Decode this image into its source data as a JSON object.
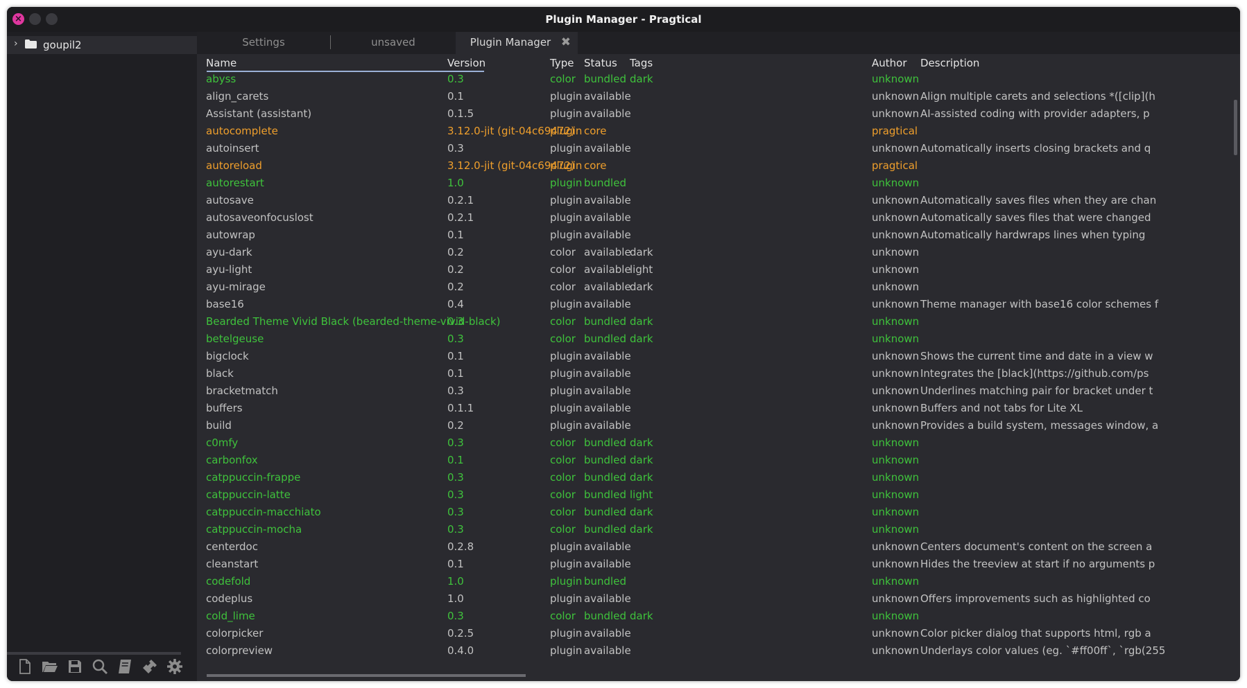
{
  "window": {
    "title": "Plugin Manager - Pragtical"
  },
  "sidebar": {
    "folder": "goupil2",
    "toolbar": [
      {
        "icon": "new-file-icon"
      },
      {
        "icon": "open-folder-icon"
      },
      {
        "icon": "save-icon"
      },
      {
        "icon": "search-icon"
      },
      {
        "icon": "book-icon"
      },
      {
        "icon": "plugin-icon"
      },
      {
        "icon": "gear-icon"
      }
    ]
  },
  "tabs": [
    {
      "label": "Settings"
    },
    {
      "label": "unsaved"
    },
    {
      "label": "Plugin Manager",
      "active": true
    }
  ],
  "table": {
    "columns": [
      "Name",
      "Version",
      "Type",
      "Status",
      "Tags",
      "Author",
      "Description"
    ],
    "status_colors": {
      "available": "#c2c2c2",
      "bundled": "#3fc23c",
      "core": "#ef9f2c"
    },
    "rows": [
      {
        "name": "abyss",
        "version": "0.3",
        "type": "color",
        "status": "bundled",
        "tags": "dark",
        "author": "unknown",
        "description": ""
      },
      {
        "name": "align_carets",
        "version": "0.1",
        "type": "plugin",
        "status": "available",
        "tags": "",
        "author": "unknown",
        "description": "Align multiple carets and selections *([clip](h"
      },
      {
        "name": "Assistant (assistant)",
        "version": "0.1.5",
        "type": "plugin",
        "status": "available",
        "tags": "",
        "author": "unknown",
        "description": "AI-assisted coding with provider adapters, p"
      },
      {
        "name": "autocomplete",
        "version": "3.12.0-jit (git-04c69472)",
        "type": "plugin",
        "status": "core",
        "tags": "",
        "author": "pragtical",
        "description": ""
      },
      {
        "name": "autoinsert",
        "version": "0.3",
        "type": "plugin",
        "status": "available",
        "tags": "",
        "author": "unknown",
        "description": "Automatically inserts closing brackets and q"
      },
      {
        "name": "autoreload",
        "version": "3.12.0-jit (git-04c69472)",
        "type": "plugin",
        "status": "core",
        "tags": "",
        "author": "pragtical",
        "description": ""
      },
      {
        "name": "autorestart",
        "version": "1.0",
        "type": "plugin",
        "status": "bundled",
        "tags": "",
        "author": "unknown",
        "description": ""
      },
      {
        "name": "autosave",
        "version": "0.2.1",
        "type": "plugin",
        "status": "available",
        "tags": "",
        "author": "unknown",
        "description": "Automatically saves files when they are chan"
      },
      {
        "name": "autosaveonfocuslost",
        "version": "0.2.1",
        "type": "plugin",
        "status": "available",
        "tags": "",
        "author": "unknown",
        "description": "Automatically saves files that were changed"
      },
      {
        "name": "autowrap",
        "version": "0.1",
        "type": "plugin",
        "status": "available",
        "tags": "",
        "author": "unknown",
        "description": "Automatically hardwraps lines when typing"
      },
      {
        "name": "ayu-dark",
        "version": "0.2",
        "type": "color",
        "status": "available",
        "tags": "dark",
        "author": "unknown",
        "description": ""
      },
      {
        "name": "ayu-light",
        "version": "0.2",
        "type": "color",
        "status": "available",
        "tags": "light",
        "author": "unknown",
        "description": ""
      },
      {
        "name": "ayu-mirage",
        "version": "0.2",
        "type": "color",
        "status": "available",
        "tags": "dark",
        "author": "unknown",
        "description": ""
      },
      {
        "name": "base16",
        "version": "0.4",
        "type": "plugin",
        "status": "available",
        "tags": "",
        "author": "unknown",
        "description": "Theme manager with base16 color schemes f"
      },
      {
        "name": "Bearded Theme Vivid Black (bearded-theme-vivid-black)",
        "version": "0.3",
        "type": "color",
        "status": "bundled",
        "tags": "dark",
        "author": "unknown",
        "description": ""
      },
      {
        "name": "betelgeuse",
        "version": "0.3",
        "type": "color",
        "status": "bundled",
        "tags": "dark",
        "author": "unknown",
        "description": ""
      },
      {
        "name": "bigclock",
        "version": "0.1",
        "type": "plugin",
        "status": "available",
        "tags": "",
        "author": "unknown",
        "description": "Shows the current time and date in a view w"
      },
      {
        "name": "black",
        "version": "0.1",
        "type": "plugin",
        "status": "available",
        "tags": "",
        "author": "unknown",
        "description": "Integrates the [black](https://github.com/ps"
      },
      {
        "name": "bracketmatch",
        "version": "0.3",
        "type": "plugin",
        "status": "available",
        "tags": "",
        "author": "unknown",
        "description": "Underlines matching pair for bracket under t"
      },
      {
        "name": "buffers",
        "version": "0.1.1",
        "type": "plugin",
        "status": "available",
        "tags": "",
        "author": "unknown",
        "description": "Buffers and not tabs for Lite XL"
      },
      {
        "name": "build",
        "version": "0.2",
        "type": "plugin",
        "status": "available",
        "tags": "",
        "author": "unknown",
        "description": "Provides a build system, messages window, a"
      },
      {
        "name": "c0mfy",
        "version": "0.3",
        "type": "color",
        "status": "bundled",
        "tags": "dark",
        "author": "unknown",
        "description": ""
      },
      {
        "name": "carbonfox",
        "version": "0.1",
        "type": "color",
        "status": "bundled",
        "tags": "dark",
        "author": "unknown",
        "description": ""
      },
      {
        "name": "catppuccin-frappe",
        "version": "0.3",
        "type": "color",
        "status": "bundled",
        "tags": "dark",
        "author": "unknown",
        "description": ""
      },
      {
        "name": "catppuccin-latte",
        "version": "0.3",
        "type": "color",
        "status": "bundled",
        "tags": "light",
        "author": "unknown",
        "description": ""
      },
      {
        "name": "catppuccin-macchiato",
        "version": "0.3",
        "type": "color",
        "status": "bundled",
        "tags": "dark",
        "author": "unknown",
        "description": ""
      },
      {
        "name": "catppuccin-mocha",
        "version": "0.3",
        "type": "color",
        "status": "bundled",
        "tags": "dark",
        "author": "unknown",
        "description": ""
      },
      {
        "name": "centerdoc",
        "version": "0.2.8",
        "type": "plugin",
        "status": "available",
        "tags": "",
        "author": "unknown",
        "description": "Centers document's content on the screen a"
      },
      {
        "name": "cleanstart",
        "version": "0.1",
        "type": "plugin",
        "status": "available",
        "tags": "",
        "author": "unknown",
        "description": "Hides the treeview at start if no arguments p"
      },
      {
        "name": "codefold",
        "version": "1.0",
        "type": "plugin",
        "status": "bundled",
        "tags": "",
        "author": "unknown",
        "description": ""
      },
      {
        "name": "codeplus",
        "version": "1.0",
        "type": "plugin",
        "status": "available",
        "tags": "",
        "author": "unknown",
        "description": "Offers improvements such as highlighted co"
      },
      {
        "name": "cold_lime",
        "version": "0.3",
        "type": "color",
        "status": "bundled",
        "tags": "dark",
        "author": "unknown",
        "description": ""
      },
      {
        "name": "colorpicker",
        "version": "0.2.5",
        "type": "plugin",
        "status": "available",
        "tags": "",
        "author": "unknown",
        "description": "Color picker dialog that supports html, rgb a"
      },
      {
        "name": "colorpreview",
        "version": "0.4.0",
        "type": "plugin",
        "status": "available",
        "tags": "",
        "author": "unknown",
        "description": "Underlays color values (eg. `#ff00ff`, `rgb(255"
      }
    ]
  }
}
